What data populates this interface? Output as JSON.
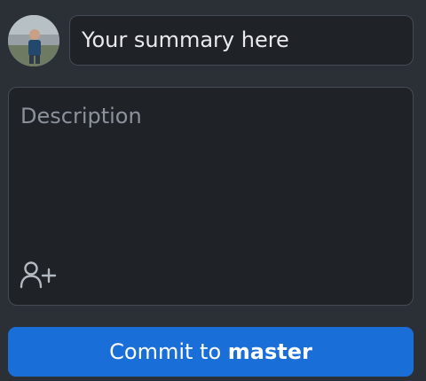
{
  "commit_form": {
    "summary_placeholder": "Your summary here",
    "description_placeholder": "Description",
    "button": {
      "prefix": "Commit to ",
      "branch": "master"
    },
    "icons": {
      "avatar": "user-avatar",
      "coauthor": "add-coauthor-icon"
    }
  },
  "colors": {
    "background": "#2b3036",
    "field_background": "#1f2328",
    "field_border": "#454b54",
    "placeholder_text": "#8b929b",
    "button_background": "#1a6ed8",
    "button_text": "#ffffff"
  }
}
